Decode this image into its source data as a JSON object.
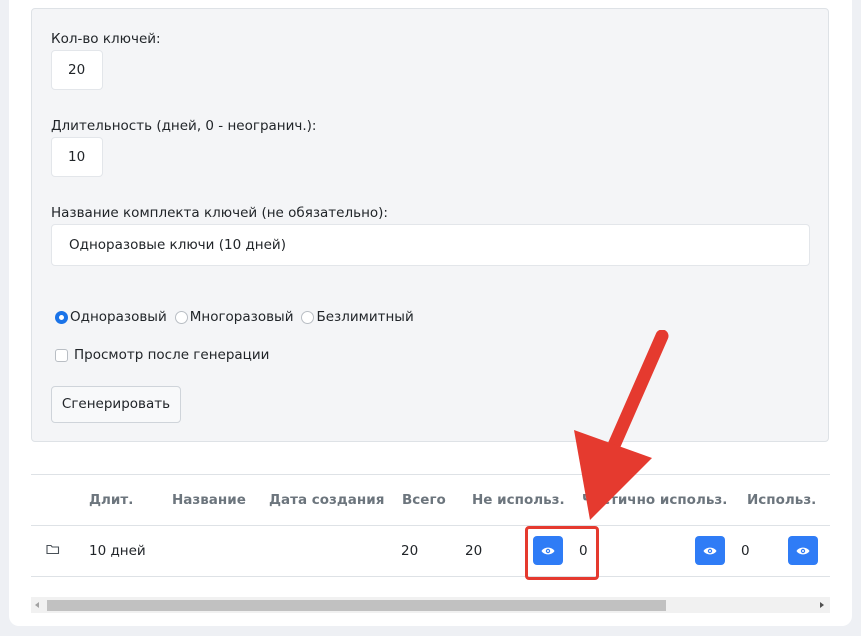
{
  "form": {
    "keys_count_label": "Кол-во ключей:",
    "keys_count_value": "20",
    "duration_label": "Длительность (дней, 0 - неогранич.):",
    "duration_value": "10",
    "set_name_label": "Название комплекта ключей (не обязательно):",
    "set_name_value": "Одноразовые ключи (10 дней)",
    "key_types": [
      {
        "label": "Одноразовый",
        "checked": true
      },
      {
        "label": "Многоразовый",
        "checked": false
      },
      {
        "label": "Безлимитный",
        "checked": false
      }
    ],
    "preview_after_label": "Просмотр после генерации",
    "generate_button": "Сгенерировать"
  },
  "table": {
    "columns": [
      "Длит.",
      "Название",
      "Дата создания",
      "Всего",
      "Не использ.",
      "Частично использ.",
      "Использ."
    ],
    "rows": [
      {
        "icon": "folder-icon",
        "duration": "10 дней",
        "name": "",
        "created": "",
        "total": "20",
        "unused": "20",
        "partial": "0",
        "used": "0"
      }
    ]
  },
  "colors": {
    "accent": "#2f7cf6",
    "annotation_red": "#e53a2f"
  }
}
